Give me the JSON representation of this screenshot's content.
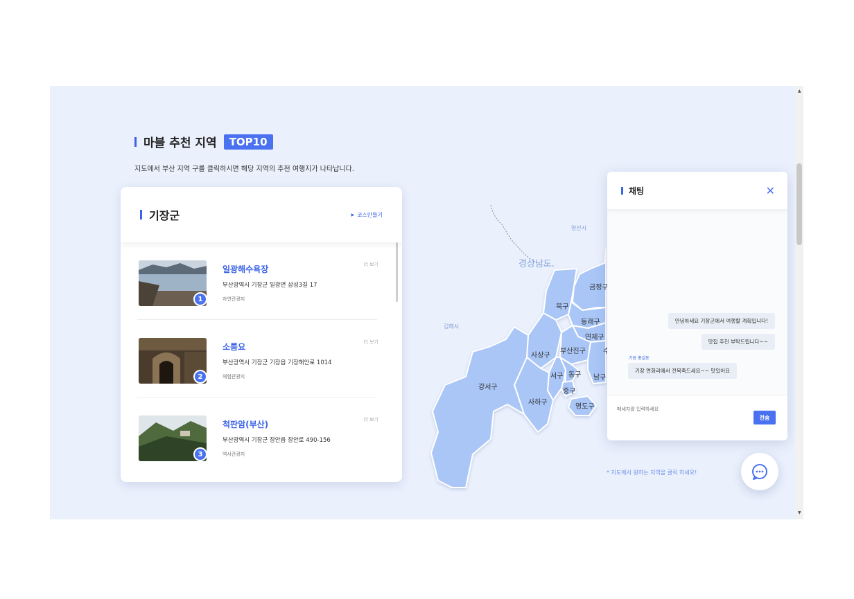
{
  "section": {
    "title": "마블 추천 지역",
    "badge": "TOP10",
    "description": "지도에서 부산 지역 구를 클릭하시면 해당 지역의 추천 여행지가 나타납니다."
  },
  "list_panel": {
    "region": "기장군",
    "course_button": "코스만들기",
    "items": [
      {
        "rank": "1",
        "name": "일광해수욕장",
        "address": "부산광역시 기장군 일광면 삼성3길 17",
        "category": "자연관광지",
        "more": "더 보기"
      },
      {
        "rank": "2",
        "name": "소룸요",
        "address": "부산광역시 기장군 기장읍 기장해안로 1014",
        "category": "체험관광지",
        "more": "더 보기"
      },
      {
        "rank": "3",
        "name": "척판암(부산)",
        "address": "부산광역시 기장군 장안읍 장안로 490-156",
        "category": "역사관광지",
        "more": "더 보기"
      }
    ]
  },
  "map": {
    "labels": {
      "gyeongnam": "경상남도",
      "yangsan": "양산시",
      "gimhae": "김해시",
      "geumjeong": "금정구",
      "buk": "북구",
      "dongnae": "동래구",
      "yeonje": "연제구",
      "sasang": "사상구",
      "busanjin": "부산진구",
      "gangseo": "강서구",
      "seo": "서구",
      "dong": "동구",
      "nam": "남구",
      "jung": "중구",
      "saha": "사하구",
      "yeongdo": "영도구",
      "suyeong": "수"
    },
    "hint": "* 지도에서 원하는 지역을 클릭 하세요!"
  },
  "chat": {
    "title": "채팅",
    "messages": [
      {
        "from": "me",
        "text": "안녕하세요 기장군에서 여행할 계획입니다!"
      },
      {
        "from": "me",
        "text": "맛집 추천 부탁드립니다~~"
      },
      {
        "from": "other",
        "sender": "기장 홍길동",
        "text": "기장 연화리에서 전복죽드세요~~ 맛있어요"
      }
    ],
    "input_placeholder": "메세지를 입력하세요",
    "send_label": "전송"
  },
  "colors": {
    "accent": "#4a72f0",
    "background": "#eaf0fc",
    "map_fill": "#a9c6f7"
  }
}
